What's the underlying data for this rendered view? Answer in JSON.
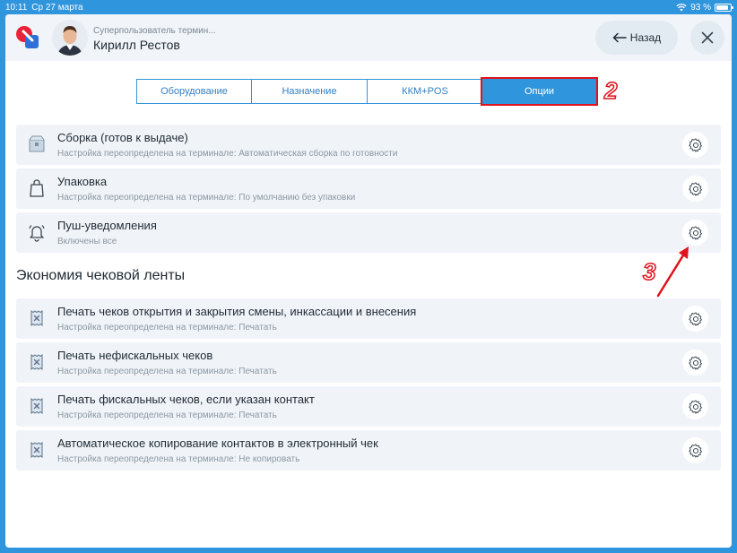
{
  "status_bar": {
    "time": "10:11",
    "date": "Ср 27 марта",
    "battery": "93 %"
  },
  "header": {
    "user_role": "Суперпользователь термин...",
    "user_name": "Кирилл Рестов",
    "back_label": "Назад"
  },
  "tabs": [
    {
      "label": "Оборудование",
      "active": false
    },
    {
      "label": "Назначение",
      "active": false
    },
    {
      "label": "ККМ+POS",
      "active": false
    },
    {
      "label": "Опции",
      "active": true
    }
  ],
  "annotations": {
    "tab_marker": "2",
    "gear_marker": "3"
  },
  "options": [
    {
      "icon": "box-icon",
      "title": "Сборка (готов к выдаче)",
      "subtitle": "Настройка переопределена на терминале: Автоматическая сборка по готовности"
    },
    {
      "icon": "bag-icon",
      "title": "Упаковка",
      "subtitle": "Настройка переопределена на терминале: По умолчанию без упаковки"
    },
    {
      "icon": "bell-icon",
      "title": "Пуш-уведомления",
      "subtitle": "Включены все"
    }
  ],
  "receipt_section": {
    "title": "Экономия чековой ленты",
    "items": [
      {
        "icon": "receipt-icon",
        "title": "Печать чеков открытия и закрытия смены, инкассации и внесения",
        "subtitle": "Настройка переопределена на терминале: Печатать"
      },
      {
        "icon": "receipt-icon",
        "title": "Печать нефискальных чеков",
        "subtitle": "Настройка переопределена на терминале: Печатать"
      },
      {
        "icon": "receipt-icon",
        "title": "Печать фискальных чеков, если указан контакт",
        "subtitle": "Настройка переопределена на терминале: Печатать"
      },
      {
        "icon": "receipt-icon",
        "title": "Автоматическое копирование контактов в электронный чек",
        "subtitle": "Настройка переопределена на терминале: Не копировать"
      }
    ]
  },
  "colors": {
    "accent": "#2f95dc",
    "annotation": "#e0121b",
    "row_bg": "#f0f4f9"
  }
}
